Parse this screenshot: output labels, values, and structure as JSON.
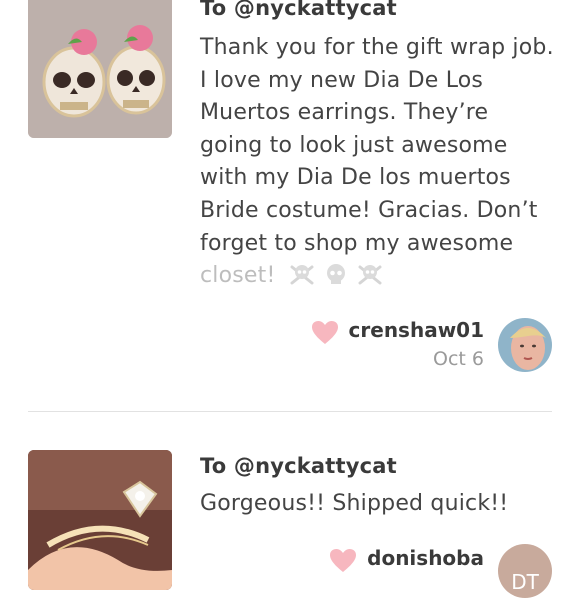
{
  "reviews": [
    {
      "to": "To @nyckattycat",
      "lines": [
        "Thank you for the gift wrap job.",
        "I love my new Dia De Los",
        "Muertos earrings. They’re",
        "going to look just awesome",
        "with my Dia De los muertos",
        "Bride costume! Gracias. Don’t",
        "forget to shop my awesome"
      ],
      "last_line": "closet!",
      "emoji": [
        "skull-and-crossbones",
        "skull",
        "skull-and-crossbones"
      ],
      "username": "crenshaw01",
      "date": "Oct 6",
      "image": "skull-earrings-photo",
      "avatar": "user-photo"
    },
    {
      "to": "To @nyckattycat",
      "lines": [
        "Gorgeous!! Shipped quick!!"
      ],
      "username": "donishoba",
      "avatar_initials": "DT",
      "image": "diamond-ring-photo"
    }
  ],
  "colors": {
    "heart": "#f7b7bf",
    "avatar_initials_bg": "#c8aa9c",
    "divider": "#e2e2e2"
  }
}
